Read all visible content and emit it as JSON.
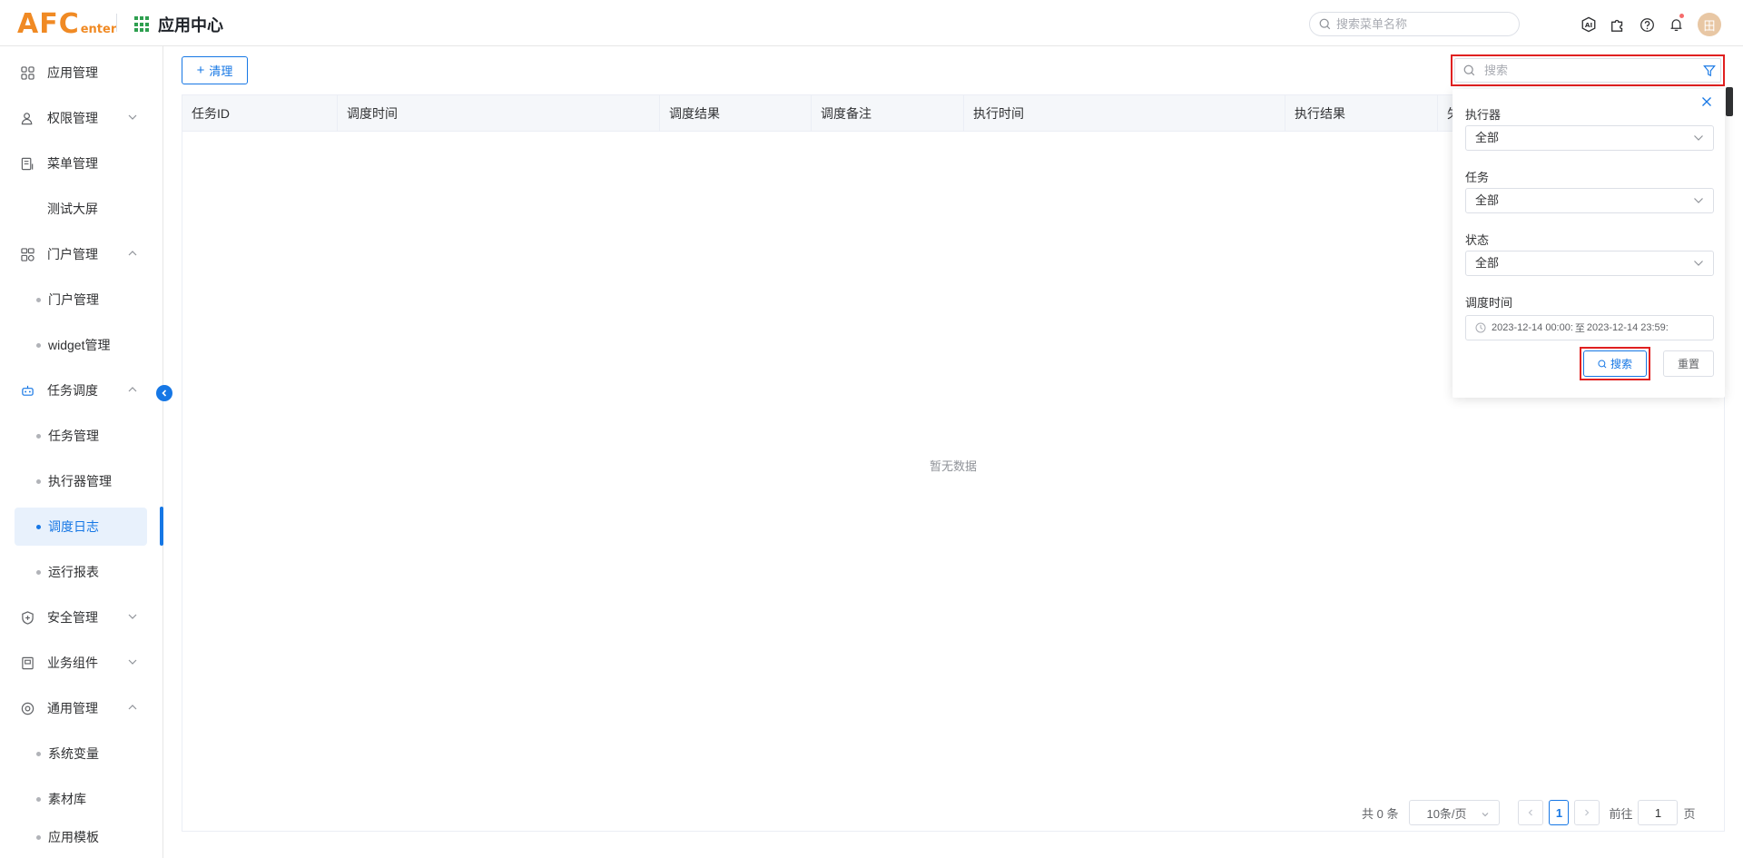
{
  "header": {
    "logo_main": "AFC",
    "logo_sub": "enter",
    "app_title": "应用中心",
    "menu_search_placeholder": "搜索菜单名称",
    "ai_label": "AI",
    "avatar_text": "田"
  },
  "sidebar": {
    "items": [
      {
        "label": "应用管理"
      },
      {
        "label": "权限管理"
      },
      {
        "label": "菜单管理"
      },
      {
        "label": "测试大屏"
      },
      {
        "label": "门户管理"
      },
      {
        "label": "门户管理"
      },
      {
        "label": "widget管理"
      },
      {
        "label": "任务调度"
      },
      {
        "label": "任务管理"
      },
      {
        "label": "执行器管理"
      },
      {
        "label": "调度日志"
      },
      {
        "label": "运行报表"
      },
      {
        "label": "安全管理"
      },
      {
        "label": "业务组件"
      },
      {
        "label": "通用管理"
      },
      {
        "label": "系统变量"
      },
      {
        "label": "素材库"
      },
      {
        "label": "应用模板"
      }
    ]
  },
  "toolbar": {
    "clean_label": "清理",
    "search_placeholder": "搜索"
  },
  "table": {
    "columns": [
      "任务ID",
      "调度时间",
      "调度结果",
      "调度备注",
      "执行时间",
      "执行结果",
      "失"
    ],
    "empty_text": "暂无数据"
  },
  "pagination": {
    "total_text": "共 0 条",
    "page_size": "10条/页",
    "current_page": "1",
    "goto_label": "前往",
    "goto_value": "1",
    "page_unit": "页"
  },
  "filter": {
    "executor_label": "执行器",
    "executor_value": "全部",
    "task_label": "任务",
    "task_value": "全部",
    "status_label": "状态",
    "status_value": "全部",
    "time_label": "调度时间",
    "time_start": "2023-12-14 00:00:",
    "time_sep": "至",
    "time_end": "2023-12-14 23:59:",
    "search_button": "搜索",
    "reset_button": "重置"
  },
  "colors": {
    "primary": "#1677e5",
    "brand": "#f08a24",
    "highlight": "#e02020"
  }
}
